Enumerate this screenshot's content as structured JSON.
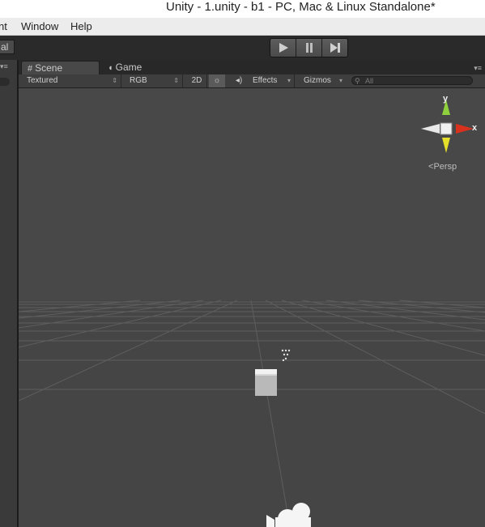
{
  "window": {
    "title": "Unity - 1.unity - b1 - PC, Mac & Linux Standalone*"
  },
  "menu": {
    "items": [
      "nt",
      "Window",
      "Help"
    ]
  },
  "toolbar": {
    "layout_label": "al"
  },
  "tabs": [
    {
      "label": "Scene"
    },
    {
      "label": "Game"
    }
  ],
  "scene_toolbar": {
    "draw_mode": "Textured",
    "render_mode": "RGB",
    "mode_2d": "2D",
    "effects": "Effects",
    "gizmos": "Gizmos",
    "search_placeholder": "All"
  },
  "gizmo": {
    "y_label": "y",
    "x_label": "x",
    "projection": "Persp"
  },
  "colors": {
    "x_axis": "#d8321e",
    "y_axis": "#8fd13c",
    "z_axis": "#e6df2a",
    "background": "#484848"
  }
}
